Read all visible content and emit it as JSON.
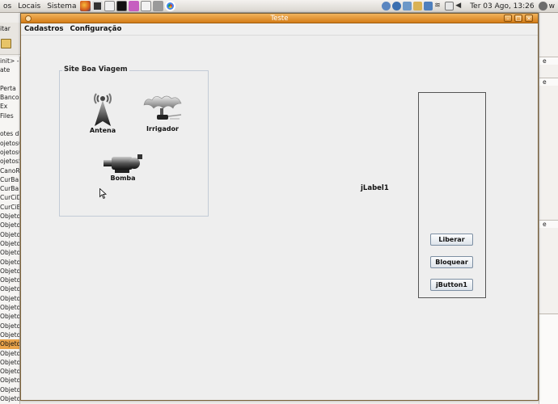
{
  "top_panel": {
    "menus": [
      "os",
      "Locais",
      "Sistema"
    ],
    "clock": "Ter 03 Ago, 13:26",
    "right_edge_text": "w"
  },
  "background_ide": {
    "toolbar_text": "itar",
    "left_tree": [
      "init> -",
      "ate",
      "",
      "Perta",
      "Banco",
      "Ex",
      "Files",
      "",
      "otes de",
      "ojetosC",
      "ojetosC",
      "ojetosS",
      "CanoR",
      "CurBa",
      "CurBa",
      "CurCiD",
      "CurCiE",
      "Objeto",
      "Objeto",
      "Objeto",
      "Objeto",
      "Objeto",
      "Objeto",
      "Objeto",
      "Objeto",
      "Objeto",
      "Objeto",
      "Objeto",
      "Objeto",
      "Objeto",
      "Objeto",
      "Objeto",
      "Objeto",
      "Objeto",
      "Objeto",
      "Objeto",
      "Objeto",
      "Objeto"
    ],
    "selected_tree_index": 31,
    "right_labels": [
      "e",
      "e",
      "e"
    ]
  },
  "window": {
    "title": "Teste",
    "menus": [
      "Cadastros",
      "Configuração"
    ],
    "group_title": "Site Boa Viagem",
    "devices": {
      "antena": "Antena",
      "irrigador": "Irrigador",
      "bomba": "Bomba"
    },
    "jlabel": "jLabel1",
    "buttons": {
      "liberar": "Liberar",
      "bloquear": "Bloquear",
      "jbutton1": "jButton1"
    }
  },
  "colors": {
    "titlebar": "#e08a20",
    "selection": "#e9a34a",
    "button_border": "#7d8fa3"
  }
}
